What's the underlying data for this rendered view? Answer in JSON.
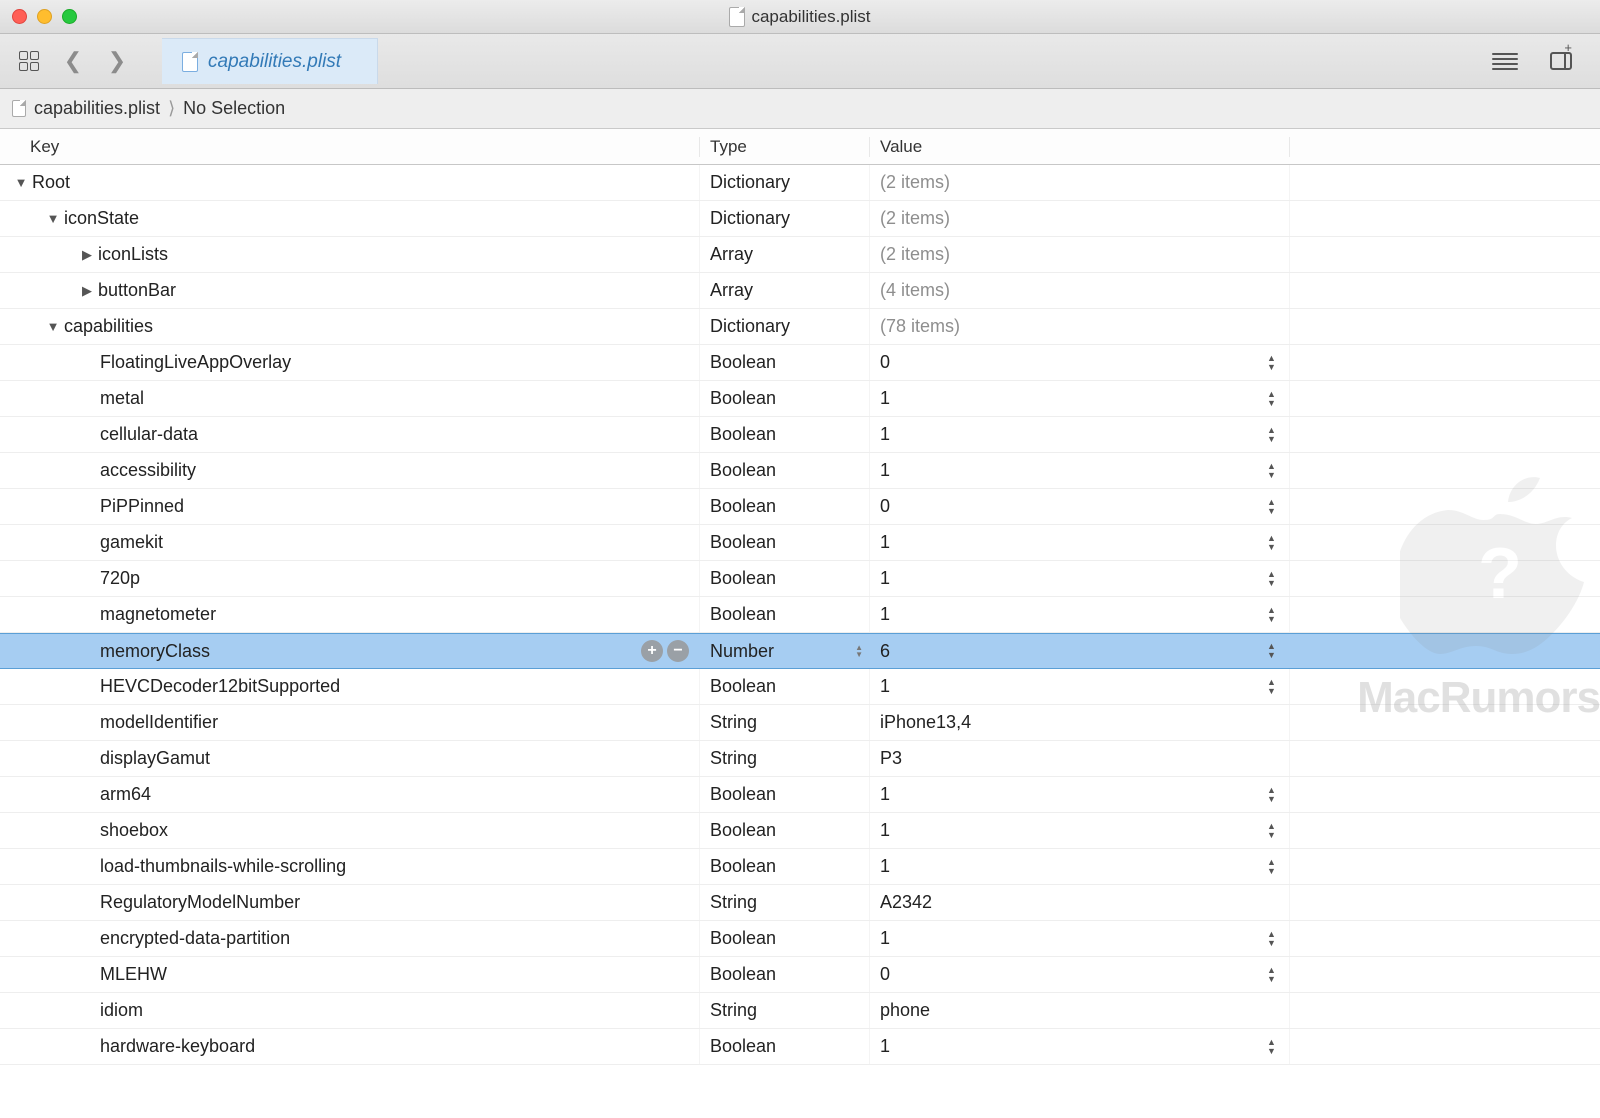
{
  "window": {
    "title": "capabilities.plist"
  },
  "tab": {
    "label": "capabilities.plist"
  },
  "pathbar": {
    "file": "capabilities.plist",
    "selection": "No Selection"
  },
  "columns": {
    "key": "Key",
    "type": "Type",
    "value": "Value"
  },
  "rows": [
    {
      "key": "Root",
      "type": "Dictionary",
      "value": "(2 items)",
      "indent": 0,
      "expanded": true,
      "valueGray": true
    },
    {
      "key": "iconState",
      "type": "Dictionary",
      "value": "(2 items)",
      "indent": 1,
      "expanded": true,
      "valueGray": true
    },
    {
      "key": "iconLists",
      "type": "Array",
      "value": "(2 items)",
      "indent": 2,
      "expanded": false,
      "valueGray": true
    },
    {
      "key": "buttonBar",
      "type": "Array",
      "value": "(4 items)",
      "indent": 2,
      "expanded": false,
      "valueGray": true
    },
    {
      "key": "capabilities",
      "type": "Dictionary",
      "value": "(78 items)",
      "indent": 1,
      "expanded": true,
      "valueGray": true
    },
    {
      "key": "FloatingLiveAppOverlay",
      "type": "Boolean",
      "value": "0",
      "indent": 3,
      "stepper": true
    },
    {
      "key": "metal",
      "type": "Boolean",
      "value": "1",
      "indent": 3,
      "stepper": true
    },
    {
      "key": "cellular-data",
      "type": "Boolean",
      "value": "1",
      "indent": 3,
      "stepper": true
    },
    {
      "key": "accessibility",
      "type": "Boolean",
      "value": "1",
      "indent": 3,
      "stepper": true
    },
    {
      "key": "PiPPinned",
      "type": "Boolean",
      "value": "0",
      "indent": 3,
      "stepper": true
    },
    {
      "key": "gamekit",
      "type": "Boolean",
      "value": "1",
      "indent": 3,
      "stepper": true
    },
    {
      "key": "720p",
      "type": "Boolean",
      "value": "1",
      "indent": 3,
      "stepper": true
    },
    {
      "key": "magnetometer",
      "type": "Boolean",
      "value": "1",
      "indent": 3,
      "stepper": true
    },
    {
      "key": "memoryClass",
      "type": "Number",
      "value": "6",
      "indent": 3,
      "stepper": true,
      "selected": true,
      "typeStepper": true,
      "addRemove": true
    },
    {
      "key": "HEVCDecoder12bitSupported",
      "type": "Boolean",
      "value": "1",
      "indent": 3,
      "stepper": true
    },
    {
      "key": "modelIdentifier",
      "type": "String",
      "value": "iPhone13,4",
      "indent": 3
    },
    {
      "key": "displayGamut",
      "type": "String",
      "value": "P3",
      "indent": 3
    },
    {
      "key": "arm64",
      "type": "Boolean",
      "value": "1",
      "indent": 3,
      "stepper": true
    },
    {
      "key": "shoebox",
      "type": "Boolean",
      "value": "1",
      "indent": 3,
      "stepper": true
    },
    {
      "key": "load-thumbnails-while-scrolling",
      "type": "Boolean",
      "value": "1",
      "indent": 3,
      "stepper": true
    },
    {
      "key": "RegulatoryModelNumber",
      "type": "String",
      "value": "A2342",
      "indent": 3
    },
    {
      "key": "encrypted-data-partition",
      "type": "Boolean",
      "value": "1",
      "indent": 3,
      "stepper": true
    },
    {
      "key": "MLEHW",
      "type": "Boolean",
      "value": "0",
      "indent": 3,
      "stepper": true
    },
    {
      "key": "idiom",
      "type": "String",
      "value": "phone",
      "indent": 3
    },
    {
      "key": "hardware-keyboard",
      "type": "Boolean",
      "value": "1",
      "indent": 3,
      "stepper": true
    }
  ],
  "watermark": "MacRumors"
}
